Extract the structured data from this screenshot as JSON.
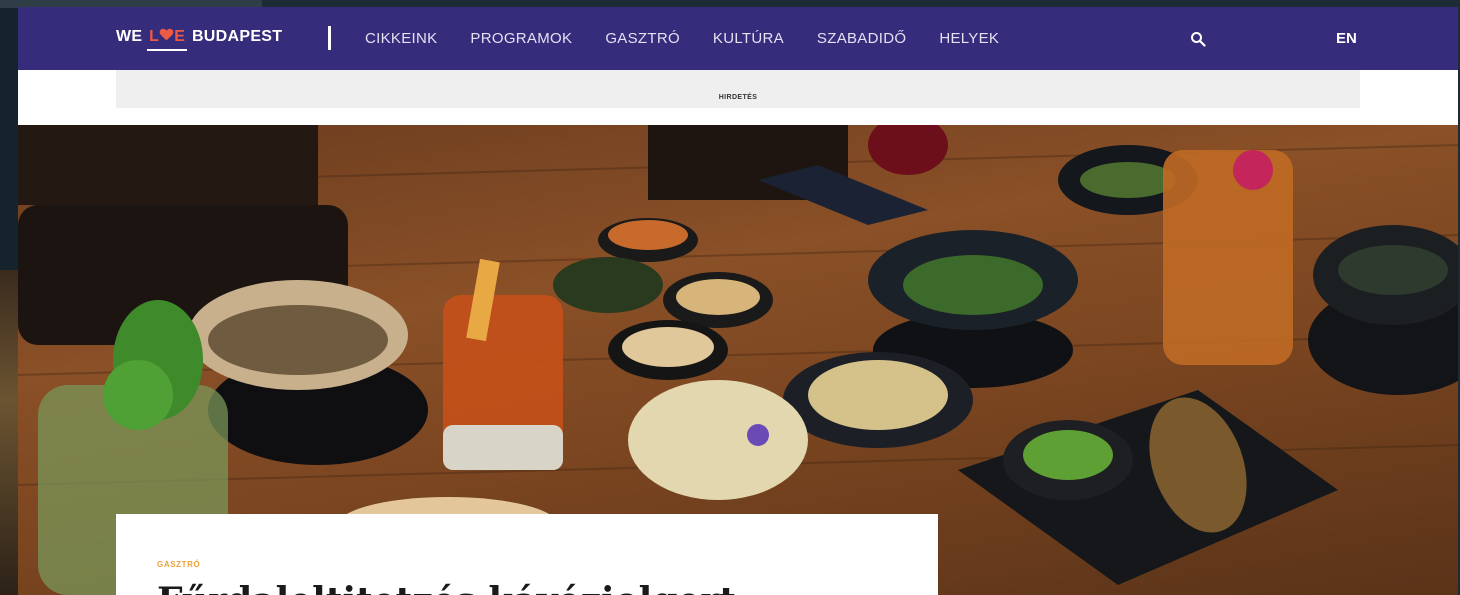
{
  "nav": {
    "logo": {
      "we": "WE",
      "love_l": "L",
      "love_e": "E",
      "budapest": "BUDAPEST"
    },
    "items": [
      "CIKKEINK",
      "PROGRAMOK",
      "GASZTRÓ",
      "KULTÚRA",
      "SZABADIDŐ",
      "HELYEK"
    ],
    "search_icon": "search-icon",
    "lang": "EN"
  },
  "ad": {
    "label": "HIRDETÉS"
  },
  "article": {
    "category": "GASZTRÓ",
    "title_partial": "Fűrdaleltitetzés kávéziolgert"
  },
  "colors": {
    "nav_bg": "#352c7b",
    "logo_accent": "#ee5a44",
    "category": "#e8a33a"
  }
}
